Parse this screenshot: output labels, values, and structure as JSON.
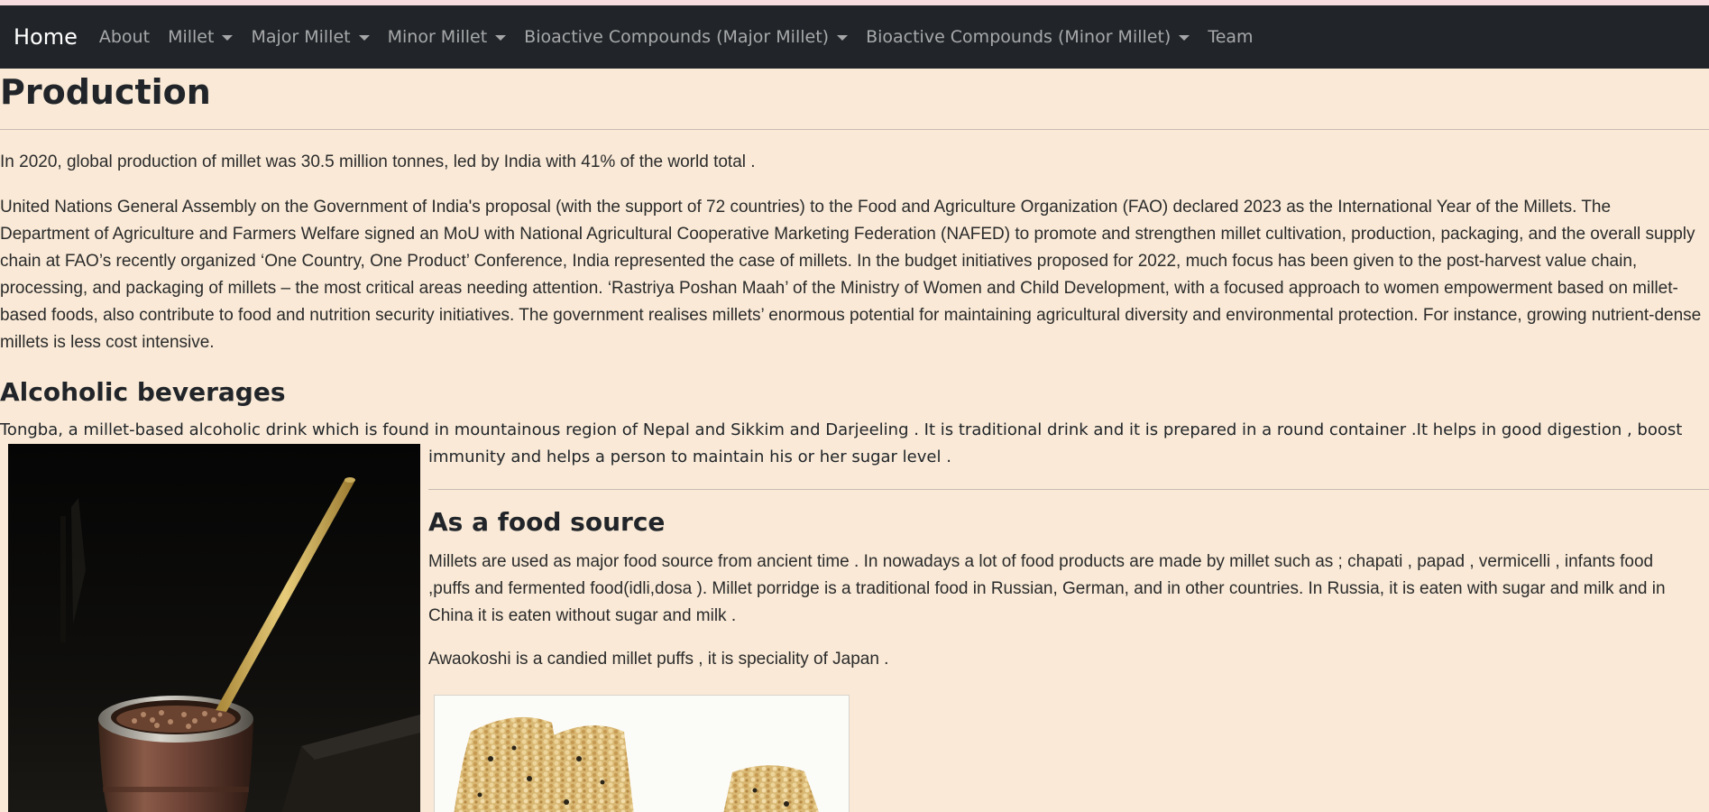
{
  "nav": {
    "brand": "Home",
    "items": [
      {
        "label": "About",
        "dropdown": false
      },
      {
        "label": "Millet",
        "dropdown": true
      },
      {
        "label": "Major Millet",
        "dropdown": true
      },
      {
        "label": "Minor Millet",
        "dropdown": true
      },
      {
        "label": "Bioactive Compounds (Major Millet)",
        "dropdown": true
      },
      {
        "label": "Bioactive Compounds (Minor Millet)",
        "dropdown": true
      },
      {
        "label": "Team",
        "dropdown": false
      }
    ]
  },
  "page": {
    "title": "Production",
    "intro": "In 2020, global production of millet was 30.5 million tonnes, led by India with 41% of the world total .",
    "un_paragraph": "United Nations General Assembly on the Government of India's proposal (with the support of 72 countries) to the Food and Agriculture Organization (FAO) declared 2023 as the International Year of the Millets. The Department of Agriculture and Farmers Welfare signed an MoU with National Agricultural Cooperative Marketing Federation (NAFED) to promote and strengthen millet cultivation, production, packaging, and the overall supply chain at FAO’s recently organized ‘One Country, One Product’ Conference, India represented the case of millets. In the budget initiatives proposed for 2022, much focus has been given to the post-harvest value chain, processing, and packaging of millets – the most critical areas needing attention. ‘Rastriya Poshan Maah’ of the Ministry of Women and Child Development, with a focused approach to women empowerment based on millet-based foods, also contribute to food and nutrition security initiatives. The government realises millets’ enormous potential for maintaining agricultural diversity and environmental protection. For instance, growing nutrient-dense millets is less cost intensive."
  },
  "alcoholic": {
    "heading": "Alcoholic beverages",
    "text_line1": "Tongba, a millet-based alcoholic drink which is found in mountainous region of Nepal and Sikkim and Darjeeling . It is traditional drink and it is prepared in a round container .It helps in good digestion , boost",
    "text_line2": "immunity and helps a person to maintain his or her sugar level ."
  },
  "food_source": {
    "heading": "As a food source",
    "paragraph": "Millets are used as major food source from ancient time . In nowadays a lot of food products are made by millet such as ; chapati , papad , vermicelli , infants food ,puffs and fermented food(idli,dosa ). Millet porridge is a traditional food in Russian, German, and in other countries. In Russia, it is eaten with sugar and milk and in China it is eaten without sugar and milk .",
    "awaokoshi": "Awaokoshi is a candied millet puffs , it is speciality of Japan ."
  },
  "colors": {
    "page_background": "#f9e9d6",
    "navbar_background": "#212529",
    "top_strip": "#f7dce0"
  }
}
